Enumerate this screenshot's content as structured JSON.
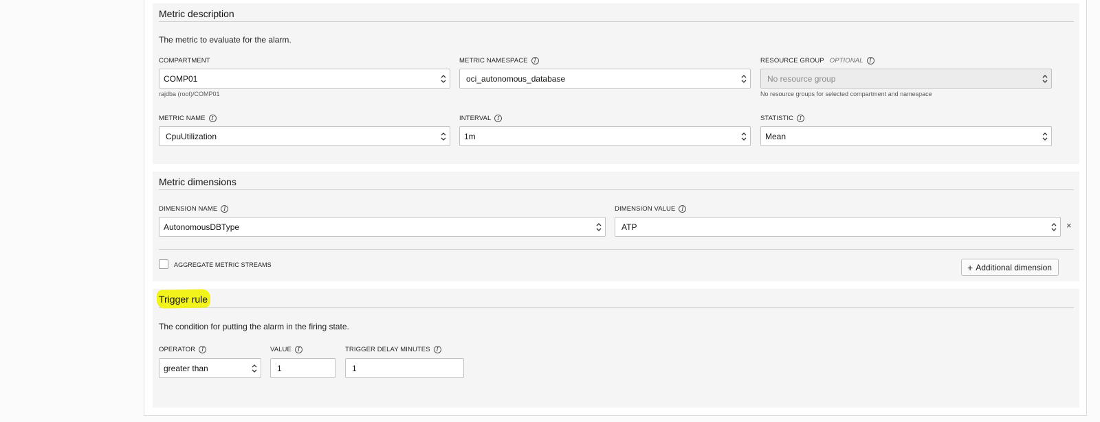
{
  "metric_description": {
    "title": "Metric description",
    "description": "The metric to evaluate for the alarm.",
    "compartment": {
      "label": "COMPARTMENT",
      "value": "COMP01",
      "path": "rajdba (root)/COMP01"
    },
    "metric_namespace": {
      "label": "METRIC NAMESPACE",
      "value": "oci_autonomous_database"
    },
    "resource_group": {
      "label": "RESOURCE GROUP",
      "optional": "OPTIONAL",
      "placeholder": "No resource group",
      "hint": "No resource groups for selected compartment and namespace"
    },
    "metric_name": {
      "label": "METRIC NAME",
      "value": "CpuUtilization"
    },
    "interval": {
      "label": "INTERVAL",
      "value": "1m"
    },
    "statistic": {
      "label": "STATISTIC",
      "value": "Mean"
    }
  },
  "metric_dimensions": {
    "title": "Metric dimensions",
    "dimension_name": {
      "label": "DIMENSION NAME",
      "value": "AutonomousDBType"
    },
    "dimension_value": {
      "label": "DIMENSION VALUE",
      "value": "ATP"
    },
    "remove_icon": "×",
    "aggregate_label": "AGGREGATE METRIC STREAMS",
    "additional_button": "Additional dimension",
    "additional_plus": "+"
  },
  "trigger_rule": {
    "title": "Trigger rule",
    "description": "The condition for putting the alarm in the firing state.",
    "operator": {
      "label": "OPERATOR",
      "value": "greater than"
    },
    "value": {
      "label": "VALUE",
      "value": "1"
    },
    "delay": {
      "label": "TRIGGER DELAY MINUTES",
      "value": "1"
    }
  },
  "icons": {
    "info": "i"
  },
  "colors": {
    "highlight": "#f3f31c",
    "panel_bg": "#f5f5f5"
  }
}
